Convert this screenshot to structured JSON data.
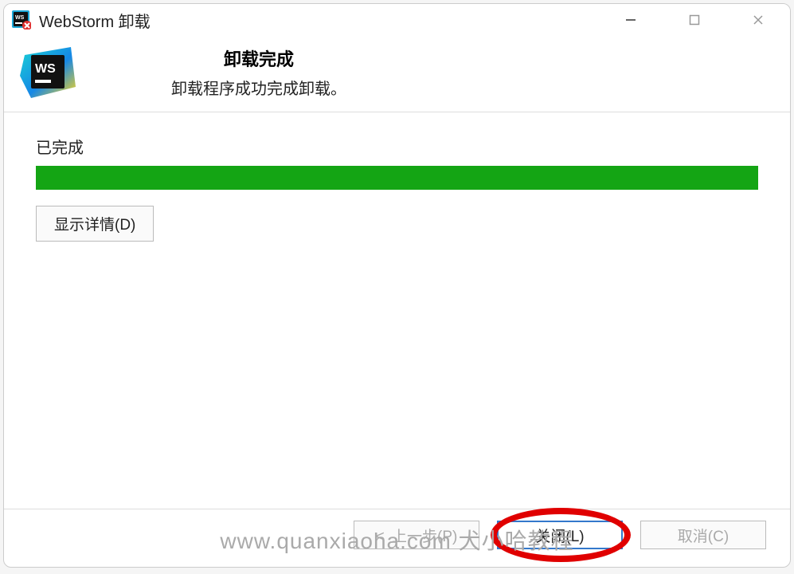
{
  "window": {
    "title": "WebStorm 卸载"
  },
  "header": {
    "heading": "卸载完成",
    "subheading": "卸载程序成功完成卸载。"
  },
  "body": {
    "status_label": "已完成",
    "details_button": "显示详情(D)",
    "progress_percent": 100,
    "progress_color": "#14a514"
  },
  "footer": {
    "back_button": "上一步(P)",
    "close_button": "关闭(L)",
    "cancel_button": "取消(C)"
  },
  "watermark": "www.quanxiaoha.com 犬小哈教程"
}
